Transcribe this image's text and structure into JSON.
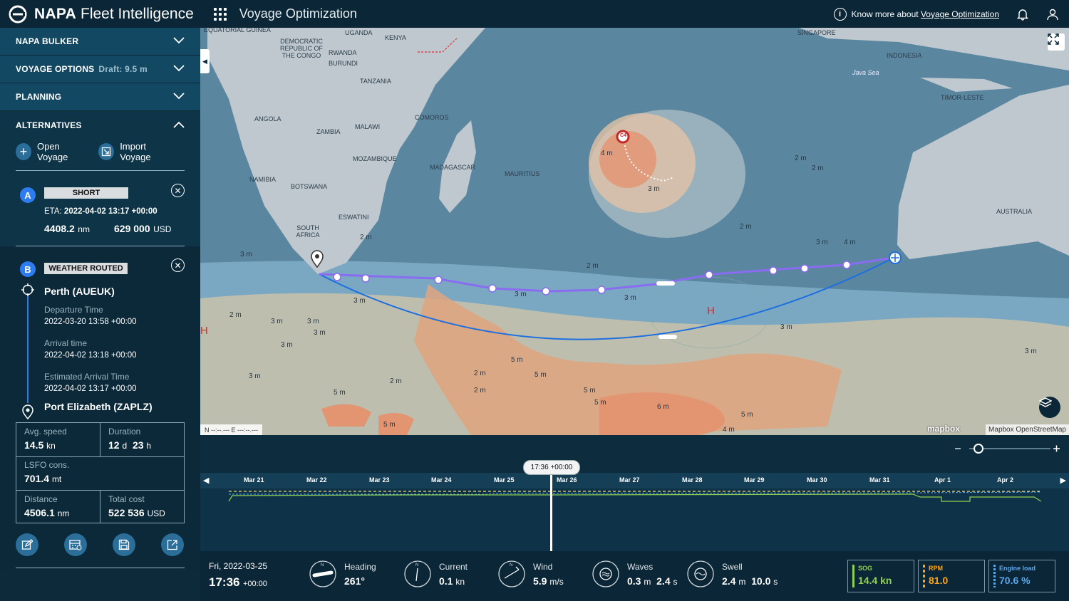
{
  "header": {
    "brand_bold": "NAPA",
    "brand_rest": "Fleet Intelligence",
    "app_title": "Voyage Optimization",
    "know_more_prefix": "Know more about",
    "know_more_link": "Voyage Optimization"
  },
  "sidebar": {
    "sections": [
      {
        "label": "NAPA BULKER",
        "sub": ""
      },
      {
        "label": "VOYAGE OPTIONS",
        "sub": "Draft: 9.5 m"
      },
      {
        "label": "PLANNING",
        "sub": ""
      },
      {
        "label": "ALTERNATIVES",
        "sub": ""
      }
    ],
    "actions": {
      "open": "Open Voyage",
      "import": "Import Voyage"
    },
    "alt_a": {
      "letter": "A",
      "tag": "SHORT",
      "eta_label": "ETA:",
      "eta": "2022-04-02 13:17 +00:00",
      "distance": "4408.2",
      "distance_unit": "nm",
      "cost": "629 000",
      "cost_unit": "USD"
    },
    "alt_b": {
      "letter": "B",
      "tag": "WEATHER ROUTED",
      "origin": "Perth (AUEUK)",
      "departure_label": "Departure Time",
      "departure": "2022-03-20 13:58 +00:00",
      "arrival_label": "Arrival time",
      "arrival": "2022-04-02 13:18 +00:00",
      "eta_label": "Estimated Arrival Time",
      "eta": "2022-04-02 13:17 +00:00",
      "destination": "Port Elizabeth (ZAPLZ)",
      "stats": {
        "avg_speed_label": "Avg. speed",
        "avg_speed": "14.5",
        "avg_speed_unit": "kn",
        "duration_label": "Duration",
        "duration_d": "12",
        "duration_h": "23",
        "lsfo_label": "LSFO cons.",
        "lsfo": "701.4",
        "lsfo_unit": "mt",
        "distance_label": "Distance",
        "distance": "4506.1",
        "distance_unit": "nm",
        "cost_label": "Total cost",
        "cost": "522 536",
        "cost_unit": "USD"
      }
    }
  },
  "map": {
    "labels": [
      "EQUATORIAL GUINEA",
      "UGANDA",
      "KENYA",
      "DEMOCRATIC REPUBLIC OF THE CONGO",
      "RWANDA",
      "BURUNDI",
      "TANZANIA",
      "ANGOLA",
      "ZAMBIA",
      "MALAWI",
      "COMOROS",
      "MOZAMBIQUE",
      "MADAGASCAR",
      "MAURITIUS",
      "NAMIBIA",
      "BOTSWANA",
      "ESWATINI",
      "SOUTH AFRICA",
      "SINGAPORE",
      "INDONESIA",
      "Java Sea",
      "TIMOR-LESTE",
      "AUSTRALIA"
    ],
    "wave_labels": [
      "4 m",
      "3 m",
      "2 m",
      "2 m",
      "2 m",
      "2 m",
      "3 m",
      "4 m",
      "3 m",
      "2 m",
      "3 m",
      "3 m",
      "3 m",
      "3 m",
      "3 m",
      "2 m",
      "3 m",
      "3 m",
      "3 m",
      "3 m",
      "5 m",
      "5 m",
      "2 m",
      "2 m",
      "5 m",
      "5 m",
      "6 m",
      "5 m",
      "4 m",
      "5 m",
      "5 m",
      "3 m",
      "2 m"
    ],
    "pressure_high": "H",
    "storm": "C4",
    "coord_text": "N   --:--.---   E   ---:--.---",
    "mapbox": "mapbox",
    "attribution": "Mapbox OpenStreetMap"
  },
  "timeline": {
    "days": [
      "Mar 21",
      "Mar 22",
      "Mar 23",
      "Mar 24",
      "Mar 25",
      "Mar 26",
      "Mar 27",
      "Mar 28",
      "Mar 29",
      "Mar 30",
      "Mar 31",
      "Apr 1",
      "Apr 2"
    ],
    "cursor_time": "17:36 +00:00"
  },
  "bottom": {
    "date": "Fri, 2022-03-25",
    "time": "17:36",
    "tz": "+00:00",
    "heading": {
      "label": "Heading",
      "value": "261°",
      "unit": ""
    },
    "current": {
      "label": "Current",
      "value": "0.1",
      "unit": "kn"
    },
    "wind": {
      "label": "Wind",
      "value": "5.9",
      "unit": "m/s"
    },
    "waves": {
      "label": "Waves",
      "value": "0.3",
      "unit": "m",
      "value2": "2.4",
      "unit2": "s"
    },
    "swell": {
      "label": "Swell",
      "value": "2.4",
      "unit": "m",
      "value2": "10.0",
      "unit2": "s"
    },
    "sog": {
      "label": "SOG",
      "value": "14.4 kn",
      "color": "#8fd14f"
    },
    "rpm": {
      "label": "RPM",
      "value": "81.0",
      "color": "#f5a623"
    },
    "engine": {
      "label": "Engine load",
      "value": "70.6 %",
      "color": "#5aa9f0"
    }
  }
}
